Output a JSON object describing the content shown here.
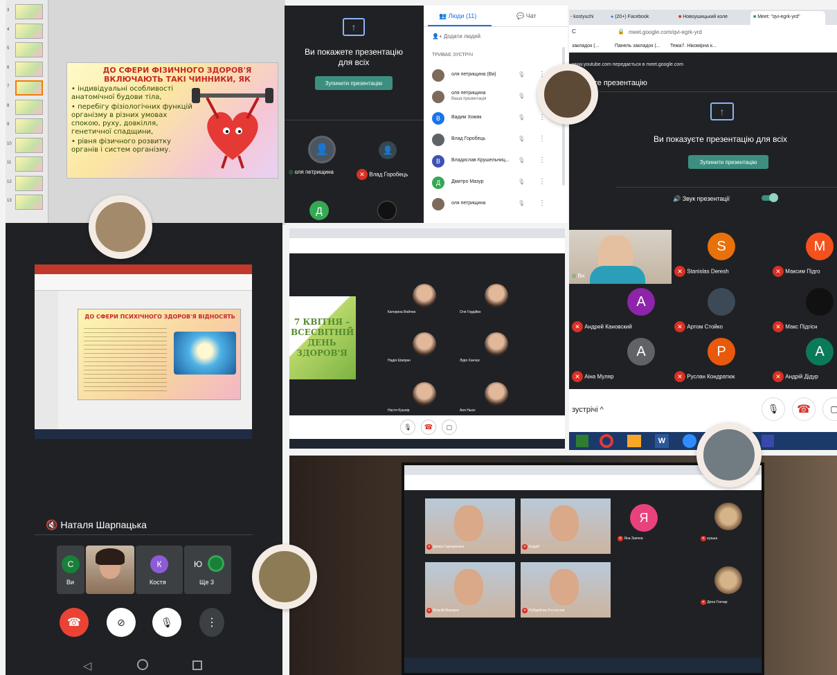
{
  "slides_panel": {
    "thumb_numbers": [
      "3",
      "4",
      "5",
      "6",
      "7",
      "8",
      "9",
      "10",
      "11",
      "12",
      "13"
    ],
    "slide": {
      "title": "ДО СФЕРИ ФІЗИЧНОГО ЗДОРОВ'Я ВКЛЮЧАЮТЬ ТАКІ ЧИННИКИ, ЯК",
      "bullets": [
        "індивідуальні особливості анатомічної будови тіла,",
        "перебігу фізіологічних функцій організму в різних умовах спокою, руху, довкілля, генетичної спадщини,",
        "рівня фізичного розвитку органів і систем організму."
      ]
    }
  },
  "meet_side": {
    "presenting_title": "Ви покажете презентацію для всіх",
    "stop_button": "Зупинити презентацію",
    "tiles": [
      {
        "name": "оля петрищина"
      },
      {
        "name": "Влад Горобець"
      }
    ],
    "letter_tile": "Д"
  },
  "people_panel": {
    "tab_people": "Люди (11)",
    "tab_chat": "Чат",
    "add_people": "Додати людей",
    "section": "ТРИВАЄ ЗУСТРІЧ",
    "people": [
      {
        "name": "оля петрищина (Ви)",
        "sub": "",
        "color": "#7d6b5a",
        "letter": ""
      },
      {
        "name": "оля петрищина",
        "sub": "Ваша презентація",
        "color": "#7d6b5a",
        "letter": ""
      },
      {
        "name": "Вадим Хомяк",
        "sub": "",
        "color": "#1a73e8",
        "letter": "В"
      },
      {
        "name": "Влад Горобець",
        "sub": "",
        "color": "#5f6368",
        "letter": ""
      },
      {
        "name": "Владислав Крушельниц...",
        "sub": "",
        "color": "#3f51b5",
        "letter": "В"
      },
      {
        "name": "Дмитро Мазур",
        "sub": "",
        "color": "#34a853",
        "letter": "Д"
      },
      {
        "name": "оля петрищина",
        "sub": "",
        "color": "#7d6b5a",
        "letter": ""
      }
    ]
  },
  "browser_top_right": {
    "tabs": [
      "- kostyuchi",
      "(20+) Facebook",
      "Новоушицький коле",
      "Meet: \"qvi-egrk-yrd\""
    ],
    "address": "meet.google.com/qvi-egrk-yrd",
    "bookmarks": [
      "закладок (...",
      "Панель закладок (...",
      "Тема7. Нікомірна к..."
    ],
    "share_notice": "www.youtube.com передається в meet.google.com",
    "banner": "ете презентацію",
    "presenting_title": "Ви показуєте презентацію для всіх",
    "stop_button": "Зупинити презентацію",
    "audio_label": "Звук презентації",
    "you_label": "Ви",
    "participants": [
      {
        "name": "Stanislas Deresh",
        "letter": "S",
        "color": "#e8710a"
      },
      {
        "name": "Максим Підго",
        "letter": "M",
        "color": "#f4511e"
      },
      {
        "name": "Андрей Кановский",
        "letter": "A",
        "color": "#8e24aa"
      },
      {
        "name": "Артом Стойко",
        "letter": "",
        "color": "#3c4a57"
      },
      {
        "name": "Макс Підгісн",
        "letter": "",
        "color": "#111111"
      },
      {
        "name": "Аіна Муляр",
        "letter": "A",
        "color": "#5f6368"
      },
      {
        "name": "Руслан Кондратюк",
        "letter": "P",
        "color": "#e8590c"
      },
      {
        "name": "Андрій Дідур",
        "letter": "A",
        "color": "#0b7a5b"
      }
    ],
    "meeting_label": "зустрічі"
  },
  "phone_panel": {
    "slide_title": "ДО СФЕРИ ПСИХІЧНОГО ЗДОРОВ'Я ВІДНОСЯТЬ",
    "presenter_name": "Наталя Шарпацька",
    "mini_tiles": [
      {
        "letter": "С",
        "label": "Ви",
        "color": "#188038"
      },
      {
        "letter": "",
        "label": "",
        "color": "#7a5540"
      },
      {
        "letter": "К",
        "label": "Костя",
        "color": "#8e5bd6"
      },
      {
        "letter": "Ю",
        "label": "Ще 3",
        "color": "#188038"
      }
    ]
  },
  "center_panel": {
    "slide_text": "7 КВІТНЯ – ВСЕСВІТНІЙ ДЕНЬ ЗДОРОВ'Я",
    "faces": [
      "Катерина Войтюк",
      "Оля Гордійко",
      "Надія Шапран",
      "Лідія Ханчук",
      "Настя Кушнір",
      "Аня Ньюх"
    ]
  },
  "laptop_panel": {
    "tiles": [
      "Іринка Гарпамелюк",
      "Андрій",
      "Яна Заячна",
      "кузька",
      "Віталій Макарич",
      "Побідейчик Ростислав",
      "Дена Гончар"
    ],
    "letter_tile": "Я"
  }
}
